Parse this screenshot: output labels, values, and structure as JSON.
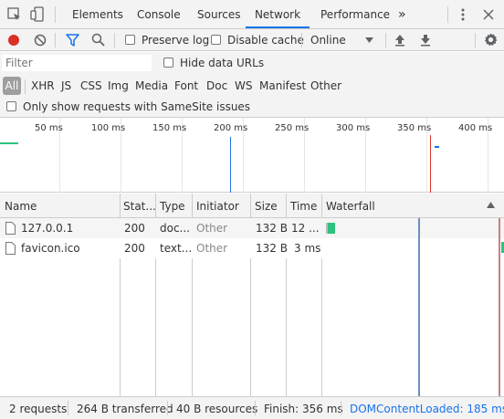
{
  "tabs": {
    "elements": "Elements",
    "console": "Console",
    "sources": "Sources",
    "network": "Network",
    "performance": "Performance",
    "more": "»"
  },
  "toolbar": {
    "preserve_log": "Preserve log",
    "disable_cache": "Disable cache",
    "throttling": "Online"
  },
  "filter": {
    "placeholder": "Filter",
    "hide_data_urls": "Hide data URLs"
  },
  "types": [
    "All",
    "XHR",
    "JS",
    "CSS",
    "Img",
    "Media",
    "Font",
    "Doc",
    "WS",
    "Manifest",
    "Other"
  ],
  "samesite": "Only show requests with SameSite issues",
  "overview": {
    "ticks": [
      "50 ms",
      "100 ms",
      "150 ms",
      "200 ms",
      "250 ms",
      "300 ms",
      "350 ms",
      "400 ms"
    ]
  },
  "table": {
    "headers": [
      "Name",
      "Stat...",
      "Type",
      "Initiator",
      "Size",
      "Time",
      "Waterfall"
    ],
    "rows": [
      [
        "127.0.0.1",
        "200",
        "doc...",
        "Other",
        "132 B",
        "12 ...",
        ""
      ],
      [
        "favicon.ico",
        "200",
        "text...",
        "Other",
        "132 B",
        "3 ms",
        ""
      ]
    ]
  },
  "status": {
    "requests": "2 requests",
    "transferred": "264 B transferred",
    "resources": "40 B resources",
    "finish": "Finish: 356 ms",
    "dcl": "DOMContentLoaded: 185 ms"
  },
  "colors": {
    "record": "#d93025",
    "filter_active": "#1a73e8",
    "dcl_line": "#1a73e8",
    "load_line": "#d93025",
    "waterfall_bar": "#2ec27e"
  }
}
